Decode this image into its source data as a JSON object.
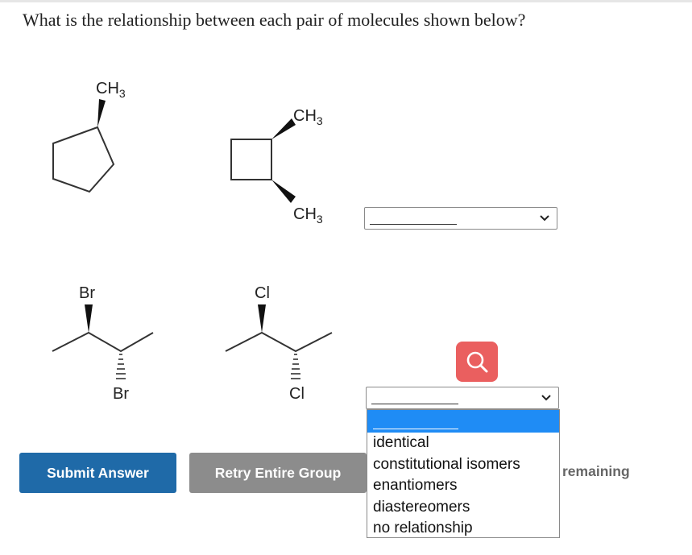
{
  "question": {
    "text": "What is the relationship between each pair of molecules shown below?"
  },
  "pairs": [
    {
      "mol_a_label": "CH3",
      "mol_b_label_top": "CH3",
      "mol_b_label_bottom": "CH3",
      "select_value": ""
    },
    {
      "mol_a_label_top": "Br",
      "mol_a_label_bottom": "Br",
      "mol_b_label_top": "Cl",
      "mol_b_label_bottom": "Cl",
      "select_value": ""
    }
  ],
  "dropdown": {
    "options": [
      "",
      "identical",
      "constitutional isomers",
      "enantiomers",
      "diastereomers",
      "no relationship"
    ]
  },
  "buttons": {
    "submit_label": "Submit Answer",
    "retry_label": "Retry Entire Group"
  },
  "status": {
    "remaining_text": "remaining"
  },
  "icons": {
    "magnifier": "magnifier-icon",
    "chevron": "chevron-down-icon"
  },
  "colors": {
    "submit_bg": "#1f6aa8",
    "retry_bg": "#8c8c8c",
    "magnifier_bg": "#ea5f5f",
    "dropdown_highlight": "#1f8cf5"
  }
}
